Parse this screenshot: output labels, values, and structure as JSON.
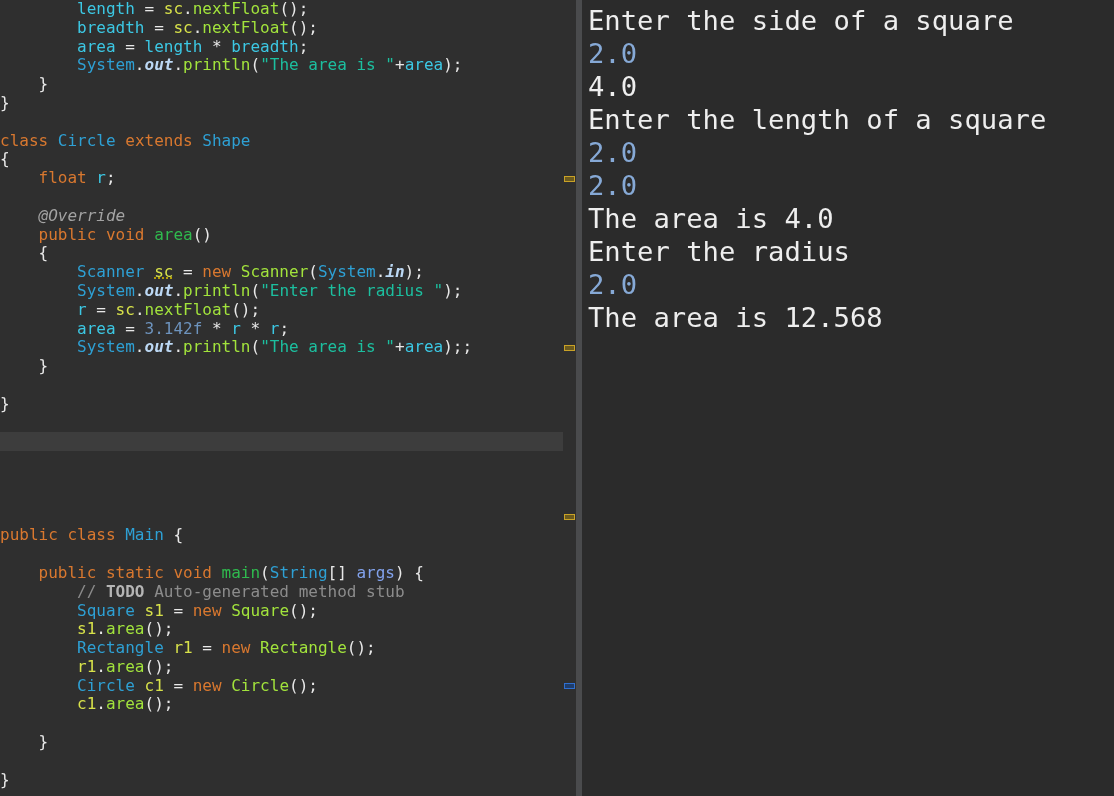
{
  "editor": {
    "lines": [
      {
        "kind": "code",
        "tokens": [
          {
            "text": "        length",
            "kind": "field"
          },
          {
            "text": " = ",
            "kind": "plain"
          },
          {
            "text": "sc",
            "kind": "local"
          },
          {
            "text": ".",
            "kind": "plain"
          },
          {
            "text": "nextFloat",
            "kind": "method"
          },
          {
            "text": "();",
            "kind": "plain"
          }
        ]
      },
      {
        "kind": "code",
        "tokens": [
          {
            "text": "        breadth",
            "kind": "field"
          },
          {
            "text": " = ",
            "kind": "plain"
          },
          {
            "text": "sc",
            "kind": "local"
          },
          {
            "text": ".",
            "kind": "plain"
          },
          {
            "text": "nextFloat",
            "kind": "method"
          },
          {
            "text": "();",
            "kind": "plain"
          }
        ]
      },
      {
        "kind": "code",
        "tokens": [
          {
            "text": "        area",
            "kind": "field"
          },
          {
            "text": " = ",
            "kind": "plain"
          },
          {
            "text": "length",
            "kind": "field"
          },
          {
            "text": " * ",
            "kind": "plain"
          },
          {
            "text": "breadth",
            "kind": "field"
          },
          {
            "text": ";",
            "kind": "plain"
          }
        ]
      },
      {
        "kind": "code",
        "tokens": [
          {
            "text": "        System",
            "kind": "type"
          },
          {
            "text": ".",
            "kind": "plain"
          },
          {
            "text": "out",
            "kind": "static"
          },
          {
            "text": ".",
            "kind": "plain"
          },
          {
            "text": "println",
            "kind": "method"
          },
          {
            "text": "(",
            "kind": "plain"
          },
          {
            "text": "\"The area is \"",
            "kind": "string"
          },
          {
            "text": "+",
            "kind": "plain"
          },
          {
            "text": "area",
            "kind": "field"
          },
          {
            "text": ");",
            "kind": "plain"
          }
        ]
      },
      {
        "kind": "code",
        "tokens": [
          {
            "text": "    }",
            "kind": "plain"
          }
        ]
      },
      {
        "kind": "code",
        "tokens": [
          {
            "text": "}",
            "kind": "plain"
          }
        ]
      },
      {
        "kind": "blank"
      },
      {
        "kind": "code",
        "tokens": [
          {
            "text": "class",
            "kind": "keyword"
          },
          {
            "text": " Circle",
            "kind": "type"
          },
          {
            "text": " extends",
            "kind": "keyword"
          },
          {
            "text": " Shape",
            "kind": "type"
          }
        ]
      },
      {
        "kind": "code",
        "tokens": [
          {
            "text": "{",
            "kind": "plain"
          }
        ]
      },
      {
        "kind": "code",
        "tokens": [
          {
            "text": "    float",
            "kind": "keyword"
          },
          {
            "text": " r",
            "kind": "field"
          },
          {
            "text": ";",
            "kind": "plain"
          }
        ],
        "marker": {
          "kind": "warning"
        }
      },
      {
        "kind": "blank"
      },
      {
        "kind": "code",
        "tokens": [
          {
            "text": "    @Override",
            "kind": "annotation"
          }
        ]
      },
      {
        "kind": "code",
        "tokens": [
          {
            "text": "    public",
            "kind": "keyword"
          },
          {
            "text": " void",
            "kind": "keyword"
          },
          {
            "text": " area",
            "kind": "methoddecl"
          },
          {
            "text": "()",
            "kind": "plain"
          }
        ]
      },
      {
        "kind": "code",
        "tokens": [
          {
            "text": "    {",
            "kind": "plain"
          }
        ]
      },
      {
        "kind": "code",
        "tokens": [
          {
            "text": "        Scanner ",
            "kind": "type"
          },
          {
            "text": "sc",
            "kind": "local_warning"
          },
          {
            "text": " = ",
            "kind": "plain"
          },
          {
            "text": "new",
            "kind": "keyword"
          },
          {
            "text": " Scanner",
            "kind": "method"
          },
          {
            "text": "(",
            "kind": "plain"
          },
          {
            "text": "System",
            "kind": "type"
          },
          {
            "text": ".",
            "kind": "plain"
          },
          {
            "text": "in",
            "kind": "static"
          },
          {
            "text": ");",
            "kind": "plain"
          }
        ]
      },
      {
        "kind": "code",
        "tokens": [
          {
            "text": "        System",
            "kind": "type"
          },
          {
            "text": ".",
            "kind": "plain"
          },
          {
            "text": "out",
            "kind": "static"
          },
          {
            "text": ".",
            "kind": "plain"
          },
          {
            "text": "println",
            "kind": "method"
          },
          {
            "text": "(",
            "kind": "plain"
          },
          {
            "text": "\"Enter the radius \"",
            "kind": "string"
          },
          {
            "text": ");",
            "kind": "plain"
          }
        ]
      },
      {
        "kind": "code",
        "tokens": [
          {
            "text": "        r",
            "kind": "field"
          },
          {
            "text": " = ",
            "kind": "plain"
          },
          {
            "text": "sc",
            "kind": "local"
          },
          {
            "text": ".",
            "kind": "plain"
          },
          {
            "text": "nextFloat",
            "kind": "method"
          },
          {
            "text": "();",
            "kind": "plain"
          }
        ]
      },
      {
        "kind": "code",
        "tokens": [
          {
            "text": "        area",
            "kind": "field"
          },
          {
            "text": " = ",
            "kind": "plain"
          },
          {
            "text": "3.142f",
            "kind": "number"
          },
          {
            "text": " * ",
            "kind": "plain"
          },
          {
            "text": "r",
            "kind": "field"
          },
          {
            "text": " * ",
            "kind": "plain"
          },
          {
            "text": "r",
            "kind": "field"
          },
          {
            "text": ";",
            "kind": "plain"
          }
        ]
      },
      {
        "kind": "code",
        "tokens": [
          {
            "text": "        System",
            "kind": "type"
          },
          {
            "text": ".",
            "kind": "plain"
          },
          {
            "text": "out",
            "kind": "static"
          },
          {
            "text": ".",
            "kind": "plain"
          },
          {
            "text": "println",
            "kind": "method"
          },
          {
            "text": "(",
            "kind": "plain"
          },
          {
            "text": "\"The area is \"",
            "kind": "string"
          },
          {
            "text": "+",
            "kind": "plain"
          },
          {
            "text": "area",
            "kind": "field"
          },
          {
            "text": ");;",
            "kind": "plain"
          }
        ],
        "marker": {
          "kind": "warning"
        }
      },
      {
        "kind": "code",
        "tokens": [
          {
            "text": "    }",
            "kind": "plain"
          }
        ]
      },
      {
        "kind": "blank"
      },
      {
        "kind": "code",
        "tokens": [
          {
            "text": "}",
            "kind": "plain"
          }
        ]
      },
      {
        "kind": "blank"
      },
      {
        "kind": "blank",
        "current": true
      },
      {
        "kind": "blank"
      },
      {
        "kind": "blank"
      },
      {
        "kind": "blank"
      },
      {
        "kind": "blank",
        "marker": {
          "kind": "warning"
        }
      },
      {
        "kind": "code",
        "tokens": [
          {
            "text": "public",
            "kind": "keyword"
          },
          {
            "text": " class",
            "kind": "keyword"
          },
          {
            "text": " Main",
            "kind": "type"
          },
          {
            "text": " {",
            "kind": "plain"
          }
        ]
      },
      {
        "kind": "blank"
      },
      {
        "kind": "code",
        "tokens": [
          {
            "text": "    public",
            "kind": "keyword"
          },
          {
            "text": " static",
            "kind": "keyword"
          },
          {
            "text": " void",
            "kind": "keyword"
          },
          {
            "text": " main",
            "kind": "methoddecl"
          },
          {
            "text": "(",
            "kind": "plain"
          },
          {
            "text": "String",
            "kind": "type"
          },
          {
            "text": "[] ",
            "kind": "plain"
          },
          {
            "text": "args",
            "kind": "param"
          },
          {
            "text": ") {",
            "kind": "plain"
          }
        ]
      },
      {
        "kind": "code",
        "tokens": [
          {
            "text": "        //",
            "kind": "comment"
          },
          {
            "text": " TODO",
            "kind": "todo"
          },
          {
            "text": " Auto-generated method stub",
            "kind": "comment"
          }
        ]
      },
      {
        "kind": "code",
        "tokens": [
          {
            "text": "        Square",
            "kind": "type"
          },
          {
            "text": " s1",
            "kind": "local"
          },
          {
            "text": " = ",
            "kind": "plain"
          },
          {
            "text": "new",
            "kind": "keyword"
          },
          {
            "text": " Square",
            "kind": "method"
          },
          {
            "text": "();",
            "kind": "plain"
          }
        ]
      },
      {
        "kind": "code",
        "tokens": [
          {
            "text": "        s1",
            "kind": "local"
          },
          {
            "text": ".",
            "kind": "plain"
          },
          {
            "text": "area",
            "kind": "method"
          },
          {
            "text": "();",
            "kind": "plain"
          }
        ]
      },
      {
        "kind": "code",
        "tokens": [
          {
            "text": "        Rectangle",
            "kind": "type"
          },
          {
            "text": " r1",
            "kind": "local"
          },
          {
            "text": " = ",
            "kind": "plain"
          },
          {
            "text": "new",
            "kind": "keyword"
          },
          {
            "text": " Rectangle",
            "kind": "method"
          },
          {
            "text": "();",
            "kind": "plain"
          }
        ]
      },
      {
        "kind": "code",
        "tokens": [
          {
            "text": "        r1",
            "kind": "local"
          },
          {
            "text": ".",
            "kind": "plain"
          },
          {
            "text": "area",
            "kind": "method"
          },
          {
            "text": "();",
            "kind": "plain"
          }
        ]
      },
      {
        "kind": "code",
        "tokens": [
          {
            "text": "        Circle",
            "kind": "type"
          },
          {
            "text": " c1",
            "kind": "local"
          },
          {
            "text": " = ",
            "kind": "plain"
          },
          {
            "text": "new",
            "kind": "keyword"
          },
          {
            "text": " Circle",
            "kind": "method"
          },
          {
            "text": "();",
            "kind": "plain"
          }
        ],
        "marker": {
          "kind": "info"
        }
      },
      {
        "kind": "code",
        "tokens": [
          {
            "text": "        c1",
            "kind": "local"
          },
          {
            "text": ".",
            "kind": "plain"
          },
          {
            "text": "area",
            "kind": "method"
          },
          {
            "text": "();",
            "kind": "plain"
          }
        ]
      },
      {
        "kind": "blank"
      },
      {
        "kind": "code",
        "tokens": [
          {
            "text": "    }",
            "kind": "plain"
          }
        ]
      },
      {
        "kind": "blank"
      },
      {
        "kind": "code",
        "tokens": [
          {
            "text": "}",
            "kind": "plain"
          }
        ]
      }
    ]
  },
  "console": {
    "lines": [
      {
        "text": "Enter the side of a square",
        "kind": "output"
      },
      {
        "text": "2.0",
        "kind": "input"
      },
      {
        "text": "4.0",
        "kind": "output"
      },
      {
        "text": "Enter the length of a square",
        "kind": "output"
      },
      {
        "text": "2.0",
        "kind": "input"
      },
      {
        "text": "2.0",
        "kind": "input"
      },
      {
        "text": "The area is 4.0",
        "kind": "output"
      },
      {
        "text": "Enter the radius",
        "kind": "output"
      },
      {
        "text": "2.0",
        "kind": "input"
      },
      {
        "text": "The area is 12.568",
        "kind": "output"
      }
    ]
  }
}
